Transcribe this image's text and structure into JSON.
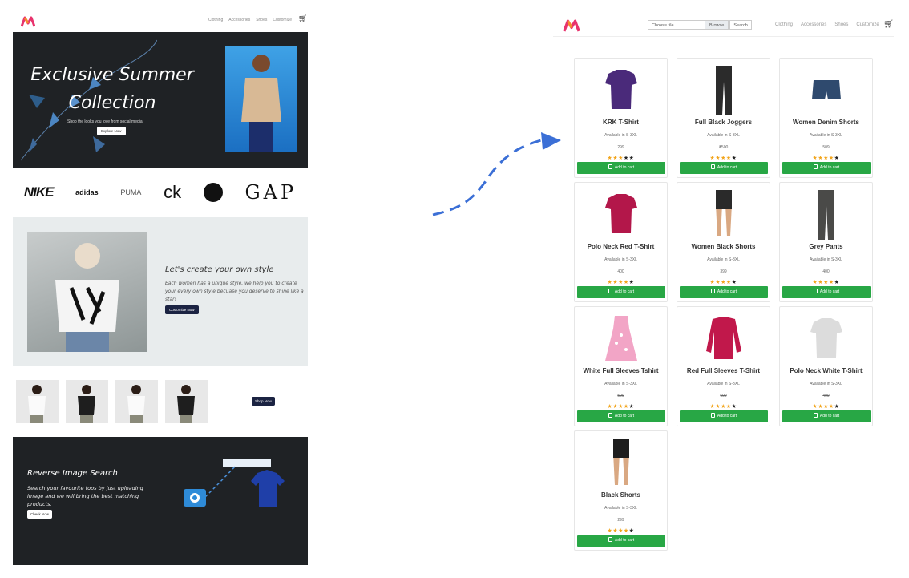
{
  "home": {
    "logo": "M",
    "nav": [
      "Clothing",
      "Accessories",
      "Shoes",
      "Customize"
    ],
    "hero": {
      "title": "Exclusive Summer Collection",
      "subtitle": "Shop the looks you love from social media",
      "button": "Explore Now"
    },
    "brands": [
      "NIKE",
      "adidas",
      "PUMA",
      "ck",
      "",
      "GAP"
    ],
    "style": {
      "title": "Let's create your own style",
      "body": "Each women has a unique style, we help you to create your every own style becuase you deserve to shine like a star!",
      "button": "Customize Now"
    },
    "shop_button": "Shop Now",
    "reverse": {
      "title": "Reverse Image Search",
      "body": "Search your favourite tops by just uploading image and we will bring the best matching products.",
      "button": "Check Now"
    }
  },
  "results": {
    "logo": "M",
    "file_placeholder": "Choose file",
    "browse": "Browse",
    "search": "Search",
    "nav": [
      "Clothing",
      "Accessories",
      "Shoes",
      "Customize"
    ],
    "add_label": "Add to cart",
    "products": [
      {
        "name": "KRK T-Shirt",
        "avail": "Available in S-3XL",
        "price": "299",
        "struck": false,
        "rating": 3,
        "color": "#4a2a7a"
      },
      {
        "name": "Full Black Joggers",
        "avail": "Available in S-3XL",
        "price": "₹500",
        "struck": false,
        "rating": 4,
        "color": "#2b2b2b"
      },
      {
        "name": "Women Denim Shorts",
        "avail": "Available in S-3XL",
        "price": "509",
        "struck": false,
        "rating": 4,
        "color": "#2f4a6e"
      },
      {
        "name": "Polo Neck Red T-Shirt",
        "avail": "Available in S-3XL",
        "price": "400",
        "struck": false,
        "rating": 4,
        "color": "#b3174a"
      },
      {
        "name": "Women Black Shorts",
        "avail": "Available in S-3XL",
        "price": "399",
        "struck": false,
        "rating": 4,
        "color": "#2a2a2a"
      },
      {
        "name": "Grey Pants",
        "avail": "Available in S-3XL",
        "price": "400",
        "struck": false,
        "rating": 4,
        "color": "#4a4a48"
      },
      {
        "name": "White Full Sleeves Tshirt",
        "avail": "Available in S-3XL",
        "price": "599",
        "struck": true,
        "rating": 4,
        "color": "#f2a5c6"
      },
      {
        "name": "Red Full Sleeves T-Shirt",
        "avail": "Available in S-3XL",
        "price": "699",
        "struck": true,
        "rating": 4,
        "color": "#c1184b"
      },
      {
        "name": "Polo Neck White T-Shirt",
        "avail": "Available in S-3XL",
        "price": "499",
        "struck": true,
        "rating": 4,
        "color": "#dcdcdc"
      },
      {
        "name": "Black Shorts",
        "avail": "Available in S-3XL",
        "price": "299",
        "struck": false,
        "rating": 4,
        "color": "#1e1e1e"
      }
    ]
  }
}
